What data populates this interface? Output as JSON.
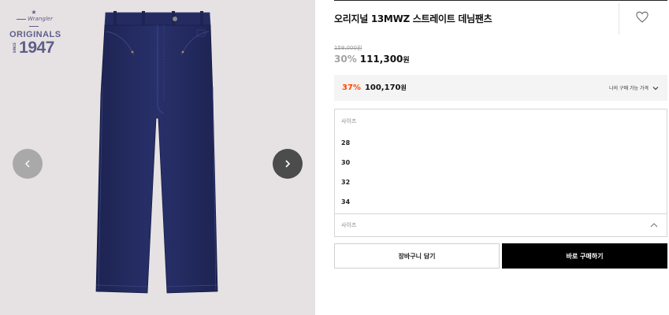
{
  "gallery": {
    "brand": {
      "wrangler": "Wrangler",
      "originals": "ORIGINALS",
      "since": "SINCE",
      "year": "1947"
    },
    "colors": {
      "background": "#e6e2e3",
      "denim": "#222a5e",
      "brand": "#5f5e8a"
    },
    "icons": {
      "prev": "chevron-left-icon",
      "next": "chevron-right-icon"
    }
  },
  "product": {
    "title": "오리지널 13MWZ 스트레이트 데님팬츠",
    "original_price": "159,000원",
    "sale_percent": "30%",
    "sale_price": "111,300",
    "sale_currency": "원"
  },
  "member_price": {
    "percent": "37%",
    "price": "100,170",
    "currency": "원",
    "link_label": "나의 구매 가능 가격",
    "accent_color": "#ff4800"
  },
  "size_dropdown": {
    "header": "사이즈",
    "options": [
      "28",
      "30",
      "32",
      "34"
    ],
    "select_placeholder": "사이즈"
  },
  "actions": {
    "cart_label": "장바구니 담기",
    "buy_label": "바로 구매하기"
  }
}
